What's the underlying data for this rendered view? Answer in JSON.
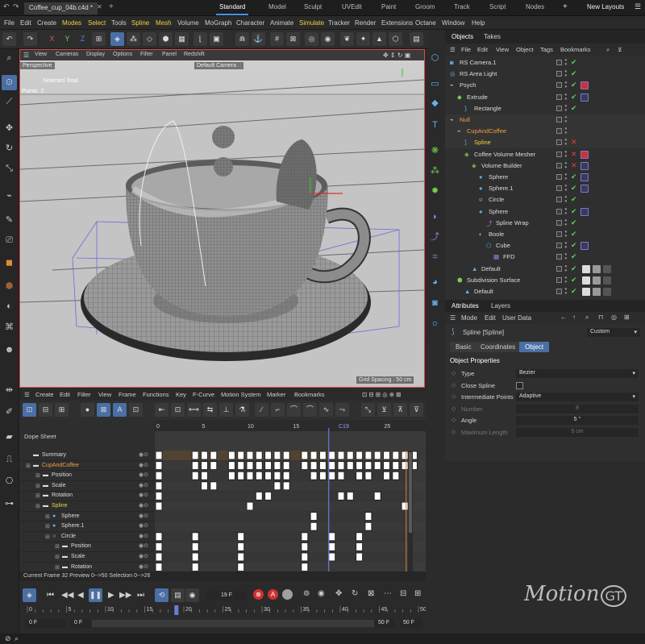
{
  "tabbar": {
    "document_tab": "Coffee_cup_04b.c4d *",
    "layouts": [
      "Standard",
      "Model",
      "Sculpt",
      "UVEdit",
      "Paint",
      "Groom",
      "Track",
      "Script",
      "Nodes"
    ],
    "active_layout": "Standard",
    "new_layouts": "New Layouts"
  },
  "menubar": [
    "File",
    "Edit",
    "Create",
    "Modes",
    "Select",
    "Tools",
    "Spline",
    "Mesh",
    "Volume",
    "MoGraph",
    "Character",
    "Animate",
    "Simulate",
    "Tracker",
    "Render",
    "Extensions",
    "Octane",
    "Window",
    "Help"
  ],
  "toolbar": {
    "axes": [
      "X",
      "Y",
      "Z"
    ]
  },
  "viewport": {
    "menu": [
      "View",
      "Cameras",
      "Display",
      "Options",
      "Filter",
      "Panel",
      "Redshift"
    ],
    "view_name": "Perspective",
    "camera": "Default Camera",
    "camera_suffix": "·:",
    "selected_total_label": "Selected Total",
    "points_label": "Points",
    "points_value": "2",
    "grid_spacing": "Grid Spacing : 50 cm"
  },
  "objects": {
    "tabs": [
      "Objects",
      "Takes"
    ],
    "menu": [
      "File",
      "Edit",
      "View",
      "Object",
      "Tags",
      "Bookmarks"
    ],
    "rows": [
      {
        "name": "RS Camera.1",
        "indent": 0,
        "color": "#dcdcdc",
        "icon": "camera-icon",
        "status": "check"
      },
      {
        "name": "RS Area Light",
        "indent": 0,
        "color": "#dcdcdc",
        "icon": "light-icon",
        "status": "check"
      },
      {
        "name": "Psych",
        "indent": 0,
        "color": "#dcdcdc",
        "icon": "null-icon",
        "status": "check"
      },
      {
        "name": "Extrude",
        "indent": 1,
        "color": "#dcdcdc",
        "icon": "extrude-icon",
        "status": "check"
      },
      {
        "name": "Rectangle",
        "indent": 2,
        "color": "#dcdcdc",
        "icon": "spline-icon",
        "status": "check"
      },
      {
        "name": "Null",
        "indent": 0,
        "color": "#f0a040",
        "icon": "null-icon",
        "status": "none"
      },
      {
        "name": "CupAndCoffee",
        "indent": 1,
        "color": "#f0a040",
        "icon": "null-icon",
        "status": "none"
      },
      {
        "name": "Spline",
        "indent": 2,
        "color": "#f0d040",
        "icon": "spline-icon",
        "status": "cross"
      },
      {
        "name": "Coffee Volume Mesher",
        "indent": 2,
        "color": "#dcdcdc",
        "icon": "mesher-icon",
        "status": "cross"
      },
      {
        "name": "Volume Builder",
        "indent": 3,
        "color": "#dcdcdc",
        "icon": "builder-icon",
        "status": "cross"
      },
      {
        "name": "Sphere",
        "indent": 4,
        "color": "#dcdcdc",
        "icon": "sphere-icon",
        "status": "check"
      },
      {
        "name": "Sphere.1",
        "indent": 4,
        "color": "#dcdcdc",
        "icon": "sphere-icon",
        "status": "check"
      },
      {
        "name": "Circle",
        "indent": 4,
        "color": "#dcdcdc",
        "icon": "circle-icon",
        "status": "check"
      },
      {
        "name": "Sphere",
        "indent": 4,
        "color": "#dcdcdc",
        "icon": "sphere-icon",
        "status": "check"
      },
      {
        "name": "Spline Wrap",
        "indent": 5,
        "color": "#dcdcdc",
        "icon": "wrap-icon",
        "status": "check"
      },
      {
        "name": "Boole",
        "indent": 4,
        "color": "#dcdcdc",
        "icon": "boole-icon",
        "status": "check"
      },
      {
        "name": "Cube",
        "indent": 5,
        "color": "#dcdcdc",
        "icon": "cube-icon",
        "status": "check"
      },
      {
        "name": "FFD",
        "indent": 6,
        "color": "#dcdcdc",
        "icon": "ffd-icon",
        "status": "check"
      },
      {
        "name": "Default",
        "indent": 3,
        "color": "#dcdcdc",
        "icon": "material-icon",
        "status": "check"
      },
      {
        "name": "Subdivision Surface",
        "indent": 1,
        "color": "#dcdcdc",
        "icon": "subdiv-icon",
        "status": "check"
      },
      {
        "name": "Default",
        "indent": 2,
        "color": "#dcdcdc",
        "icon": "material-icon",
        "status": "check"
      }
    ]
  },
  "attributes": {
    "tabs": [
      "Attributes",
      "Layers"
    ],
    "menu": [
      "Mode",
      "Edit",
      "User Data"
    ],
    "object_title": "Spline [Spline]",
    "preset": "Custom",
    "subtabs": [
      "Basic",
      "Coordinates",
      "Object"
    ],
    "active_subtab": "Object",
    "section": "Object Properties",
    "props": [
      {
        "label": "Type",
        "value": "Bezier",
        "kind": "dropdown",
        "dim": false
      },
      {
        "label": "Close Spline",
        "value": "",
        "kind": "checkbox",
        "dim": false
      },
      {
        "label": "Intermediate Points",
        "value": "Adaptive",
        "kind": "dropdown",
        "dim": false
      },
      {
        "label": "Number",
        "value": "8",
        "kind": "number",
        "dim": true
      },
      {
        "label": "Angle",
        "value": "5 °",
        "kind": "number",
        "dim": false
      },
      {
        "label": "Maximum Length",
        "value": "5 cm",
        "kind": "number",
        "dim": true
      }
    ]
  },
  "timeline": {
    "menu": [
      "Create",
      "Edit",
      "Filter",
      "View",
      "Frame",
      "Functions",
      "Key",
      "F-Curve",
      "Motion System",
      "Marker",
      "Bookmarks"
    ],
    "title": "Dope Sheet",
    "ruler": [
      "0",
      "5",
      "10",
      "15",
      "C19",
      "25"
    ],
    "tracks": [
      {
        "name": "Summary",
        "indent": 0,
        "color": "#dcdcdc"
      },
      {
        "name": "CupAndCoffee",
        "indent": 0,
        "color": "#f0a040"
      },
      {
        "name": "Position",
        "indent": 1,
        "color": "#dcdcdc"
      },
      {
        "name": "Scale",
        "indent": 1,
        "color": "#dcdcdc"
      },
      {
        "name": "Rotation",
        "indent": 1,
        "color": "#dcdcdc"
      },
      {
        "name": "Spline",
        "indent": 1,
        "color": "#f0d040"
      },
      {
        "name": "Sphere",
        "indent": 2,
        "color": "#dcdcdc"
      },
      {
        "name": "Sphere.1",
        "indent": 2,
        "color": "#dcdcdc"
      },
      {
        "name": "Circle",
        "indent": 2,
        "color": "#dcdcdc"
      },
      {
        "name": "Position",
        "indent": 3,
        "color": "#dcdcdc"
      },
      {
        "name": "Scale",
        "indent": 3,
        "color": "#dcdcdc"
      },
      {
        "name": "Rotation",
        "indent": 3,
        "color": "#dcdcdc"
      }
    ],
    "status": "Current Frame  32  Preview  0-->50    Selection  0-->26"
  },
  "transport": {
    "current_frame": "19 F",
    "ruler": [
      "0",
      "5",
      "10",
      "15",
      "20",
      "25",
      "30",
      "35",
      "40",
      "45",
      "50"
    ],
    "start_a": "0 F",
    "start_b": "0 F",
    "end_a": "50 F",
    "end_b": "50 F"
  },
  "logo": {
    "text": "Motion",
    "mark": "GT"
  }
}
